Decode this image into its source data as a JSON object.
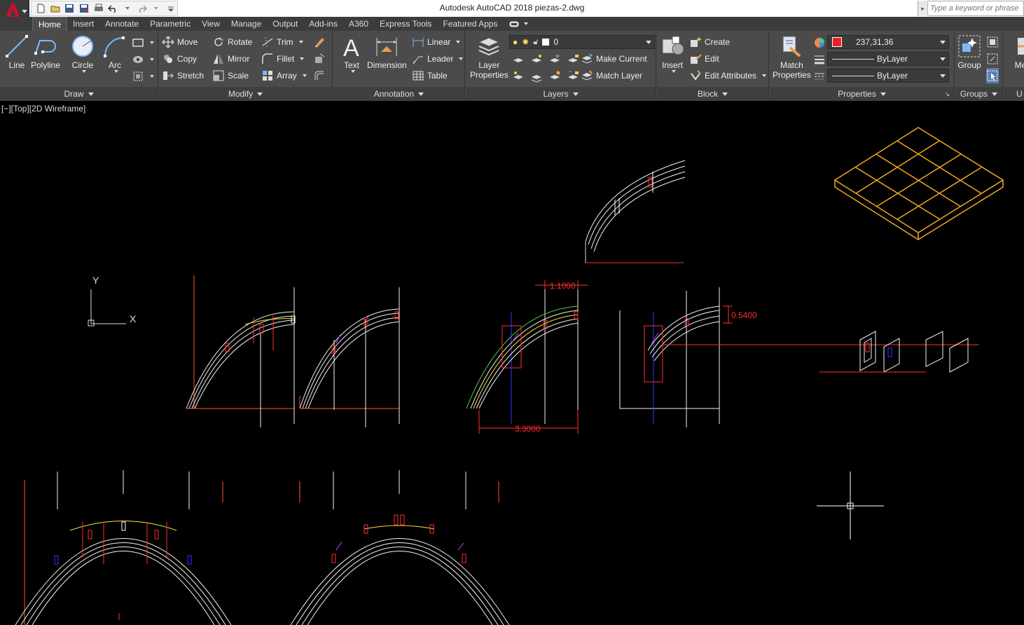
{
  "title_bar": {
    "title": "Autodesk AutoCAD 2018    piezas-2.dwg",
    "search_placeholder": "Type a keyword or phrase",
    "qat_icons": [
      "new-icon",
      "open-icon",
      "save-icon",
      "save-as-icon",
      "print-icon",
      "undo-icon",
      "redo-icon",
      "customize-icon"
    ]
  },
  "tabs": [
    "Home",
    "Insert",
    "Annotate",
    "Parametric",
    "View",
    "Manage",
    "Output",
    "Add-ins",
    "A360",
    "Express Tools",
    "Featured Apps"
  ],
  "active_tab": "Home",
  "ribbon": {
    "draw": {
      "title": "Draw",
      "line": "Line",
      "polyline": "Polyline",
      "circle": "Circle",
      "arc": "Arc"
    },
    "modify": {
      "title": "Modify",
      "move": "Move",
      "rotate": "Rotate",
      "trim": "Trim",
      "copy": "Copy",
      "mirror": "Mirror",
      "fillet": "Fillet",
      "stretch": "Stretch",
      "scale": "Scale",
      "array": "Array"
    },
    "annotation": {
      "title": "Annotation",
      "text": "Text",
      "dimension": "Dimension",
      "linear": "Linear",
      "leader": "Leader",
      "table": "Table"
    },
    "layers": {
      "title": "Layers",
      "layer_properties_1": "Layer",
      "layer_properties_2": "Properties",
      "current_layer": "0",
      "make_current": "Make Current",
      "match_layer": "Match Layer"
    },
    "block": {
      "title": "Block",
      "insert": "Insert",
      "create": "Create",
      "edit": "Edit",
      "edit_attributes": "Edit Attributes"
    },
    "properties": {
      "title": "Properties",
      "match_1": "Match",
      "match_2": "Properties",
      "color": "237,31,36",
      "color_hex": "#ed1f24",
      "linetype": "ByLayer",
      "lineweight": "ByLayer"
    },
    "groups": {
      "title": "Groups",
      "group": "Group"
    },
    "clipped": {
      "label_1": "Me",
      "label_2": "U"
    }
  },
  "viewport": {
    "label": "[−][Top][2D Wireframe]",
    "ucs_x": "X",
    "ucs_y": "Y",
    "dimensions": {
      "top": "1.1000",
      "right": "0.5400",
      "bottom": "3.3000"
    }
  }
}
